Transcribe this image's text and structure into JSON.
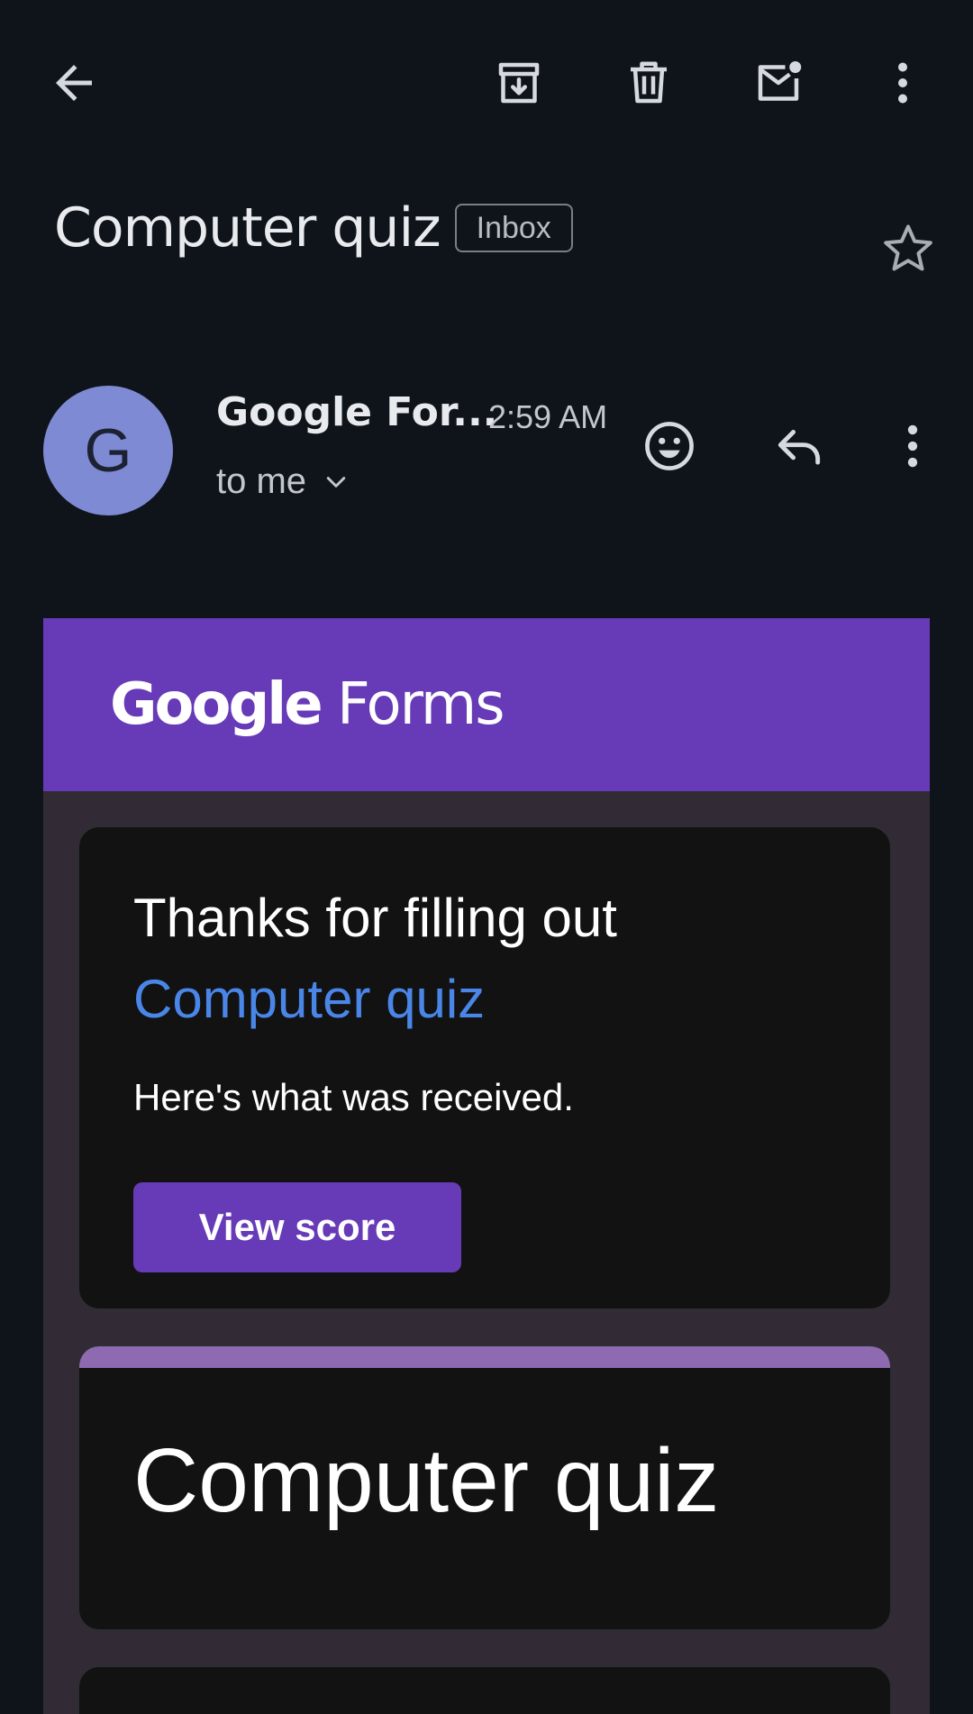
{
  "toolbar": {
    "back_icon": "arrow-left-icon",
    "archive_icon": "archive-icon",
    "delete_icon": "trash-icon",
    "mark_unread_icon": "mail-unread-icon",
    "more_icon": "more-vert-icon"
  },
  "subject": {
    "title": "Computer quiz",
    "label": "Inbox",
    "star_icon": "star-outline-icon"
  },
  "sender": {
    "avatar_letter": "G",
    "avatar_color": "#7e8ad3",
    "name": "Google For...",
    "time": "2:59 AM",
    "recipient": "to me",
    "emoji_icon": "emoji-reaction-icon",
    "reply_icon": "reply-icon",
    "more_icon": "more-vert-icon"
  },
  "email": {
    "header": {
      "logo_google": "Google",
      "logo_forms": "Forms",
      "color": "#673ab7"
    },
    "thanks_card": {
      "line1": "Thanks for filling out",
      "form_link": "Computer quiz",
      "received": "Here's what was received.",
      "button_label": "View score"
    },
    "title_card": {
      "title": "Computer quiz",
      "accent_color": "#8e6ab0"
    }
  }
}
